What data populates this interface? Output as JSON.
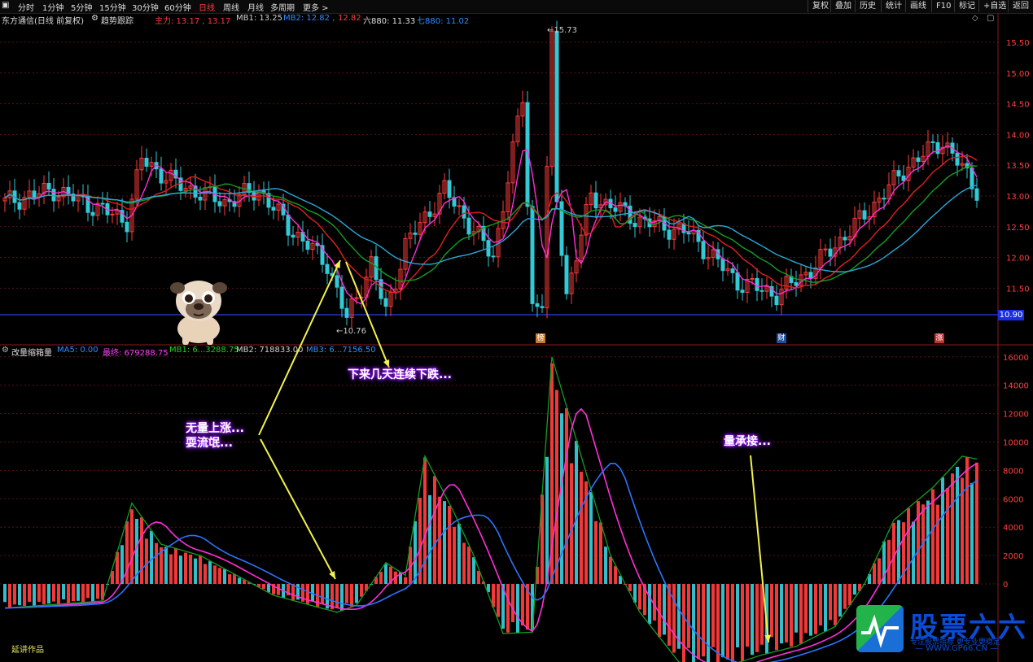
{
  "toolbar": {
    "tabs": [
      "分时",
      "1分钟",
      "5分钟",
      "15分钟",
      "30分钟",
      "60分钟",
      "日线",
      "周线",
      "月线",
      "多周期",
      "更多 >"
    ],
    "active_tab": "日线",
    "right_buttons": [
      "复权",
      "叠加",
      "历史",
      "统计",
      "画线",
      "F10",
      "标记",
      "+自选",
      "返回"
    ]
  },
  "main_info": {
    "stock_name": "东方通信(日线 前复权)",
    "indicator_name": "趋势跟踪",
    "items": [
      {
        "label": "主力: 13.17 , 13.17",
        "color": "#ff3b3b"
      },
      {
        "label": "MB1: 13.25",
        "color": "#cfcfcf"
      },
      {
        "label": "MB2: 12.82 ,",
        "color": "#2e8cff"
      },
      {
        "label": "12.82",
        "color": "#ff3b3b"
      },
      {
        "label": "六880: 11.33",
        "color": "#e0e0e0"
      },
      {
        "label": "七880: 11.02",
        "color": "#2e8cff"
      }
    ]
  },
  "price_axis": {
    "ticks": [
      "15.50",
      "15.00",
      "14.50",
      "14.00",
      "13.50",
      "13.00",
      "12.50",
      "12.00",
      "11.50"
    ],
    "current": "10.90"
  },
  "price_annotations": {
    "high": "15.73",
    "low": "10.76"
  },
  "event_markers": [
    "榜",
    "财",
    "涨"
  ],
  "indicator_info": {
    "name": "改量缩箱量",
    "items": [
      {
        "label": "MA5: 0.00",
        "color": "#2e8cff"
      },
      {
        "label": "最终: 679288.75",
        "color": "#ff40ff"
      },
      {
        "label": "MB1: 6...3288.75",
        "color": "#22cc22"
      },
      {
        "label": "MB2: 718833.00",
        "color": "#cfcfcf"
      },
      {
        "label": "MB3: 6...7156.50",
        "color": "#2e8cff"
      }
    ]
  },
  "volume_axis": {
    "ticks": [
      "16000",
      "14000",
      "12000",
      "10000",
      "8000",
      "6000",
      "4000",
      "2000",
      "0"
    ]
  },
  "callouts": [
    {
      "lines": [
        "下来几天连续下跌..."
      ]
    },
    {
      "lines": [
        "无量上涨...",
        "耍流氓..."
      ]
    },
    {
      "lines": [
        "量承接..."
      ]
    }
  ],
  "footer": "延讲作品",
  "watermark": {
    "title": "股票六六",
    "subtitle": "专注股票指标 更专业更稳定",
    "url": "— WWW.GP66.CN —"
  },
  "colors": {
    "up": "#ff3b3b",
    "down": "#33c9d6",
    "ma_magenta": "#ff2fd8",
    "ma_red": "#e02020",
    "ma_green": "#139e23",
    "ma_blue": "#2b74ff",
    "arrow": "#f2f24a"
  }
}
